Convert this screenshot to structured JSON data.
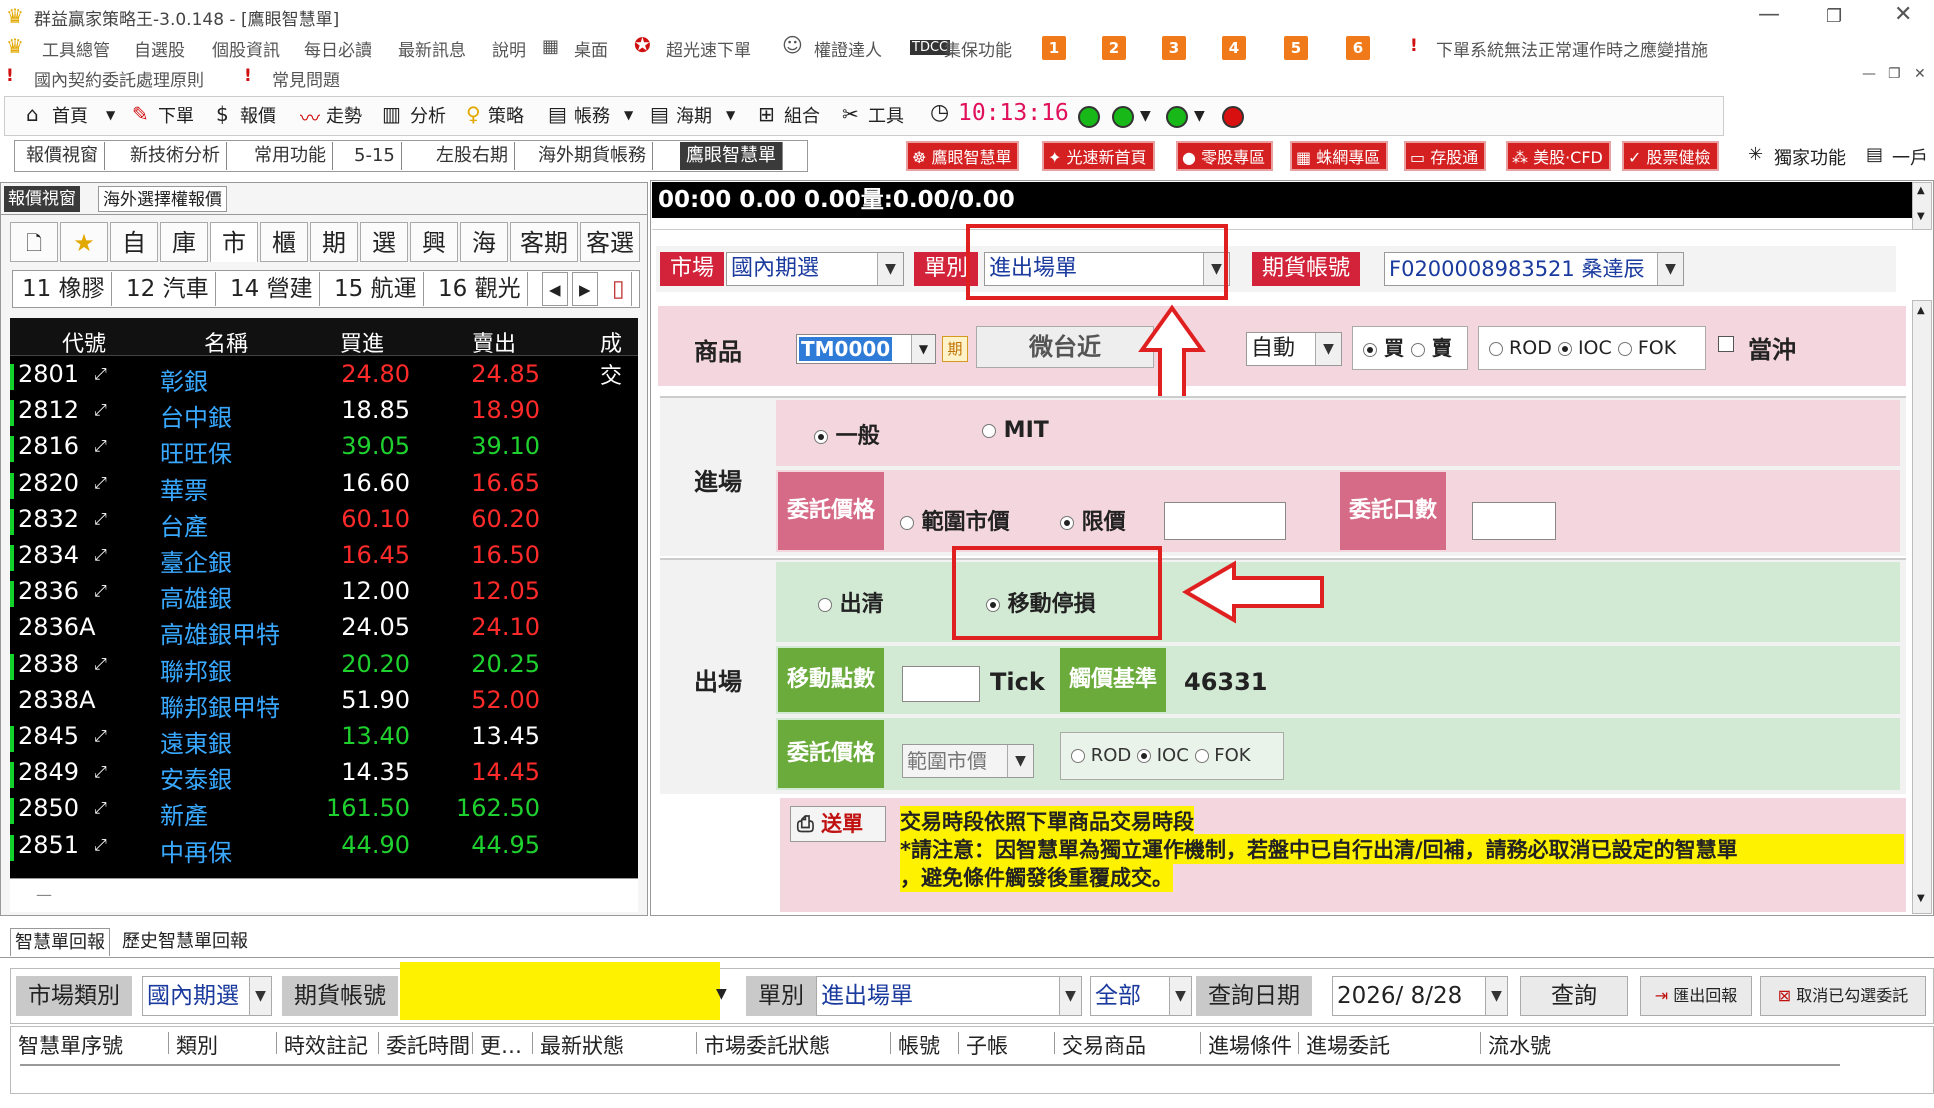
{
  "window": {
    "title": "群益贏家策略王-3.0.148 - [鷹眼智慧單]"
  },
  "menu": {
    "items": [
      "工具總管",
      "自選股",
      "個股資訊",
      "每日必讀",
      "最新訊息",
      "說明",
      "桌面",
      "超光速下單",
      "權證達人",
      "集保功能"
    ],
    "numbers": [
      "1",
      "2",
      "3",
      "4",
      "5",
      "6"
    ],
    "notice": "下單系統無法正常運作時之應變措施",
    "row2": [
      "國內契約委託處理原則",
      "常見問題"
    ]
  },
  "toolbar": {
    "items": [
      "首頁",
      "下單",
      "報價",
      "走勢",
      "分析",
      "策略",
      "帳務",
      "海期",
      "組合",
      "工具"
    ],
    "clock": "10:13:16"
  },
  "tabs": {
    "items": [
      "報價視窗",
      "新技術分析",
      "常用功能",
      "5-15",
      "左股右期",
      "海外期貨帳務",
      "鷹眼智慧單"
    ],
    "active": "鷹眼智慧單"
  },
  "redbuttons": [
    "鷹眼智慧單",
    "光速新首頁",
    "零股專區",
    "蛛網專區",
    "存股通",
    "美股·CFD",
    "股票健檢"
  ],
  "extra_buttons": [
    "獨家功能",
    "一戶"
  ],
  "left": {
    "tabs": [
      "報價視窗",
      "海外選擇權報價"
    ],
    "cattabs": [
      "自",
      "庫",
      "市",
      "櫃",
      "期",
      "選",
      "興",
      "海",
      "客期",
      "客選"
    ],
    "groups": [
      "11 橡膠",
      "12 汽車",
      "14 營建",
      "15 航運",
      "16 觀光"
    ],
    "columns": [
      "代號",
      "名稱",
      "買進",
      "賣出",
      "成交"
    ],
    "rows": [
      {
        "code": "2801",
        "name": "彰銀",
        "bid": "24.80",
        "ask": "24.85",
        "bidc": "#ff2a2a",
        "askc": "#ff2a2a",
        "mark": true
      },
      {
        "code": "2812",
        "name": "台中銀",
        "bid": "18.85",
        "ask": "18.90",
        "bidc": "#ffffff",
        "askc": "#ff2a2a",
        "mark": true
      },
      {
        "code": "2816",
        "name": "旺旺保",
        "bid": "39.05",
        "ask": "39.10",
        "bidc": "#1ed12e",
        "askc": "#1ed12e",
        "mark": true
      },
      {
        "code": "2820",
        "name": "華票",
        "bid": "16.60",
        "ask": "16.65",
        "bidc": "#ffffff",
        "askc": "#ff2a2a",
        "mark": true
      },
      {
        "code": "2832",
        "name": "台產",
        "bid": "60.10",
        "ask": "60.20",
        "bidc": "#ff2a2a",
        "askc": "#ff2a2a",
        "mark": true
      },
      {
        "code": "2834",
        "name": "臺企銀",
        "bid": "16.45",
        "ask": "16.50",
        "bidc": "#ff2a2a",
        "askc": "#ff2a2a",
        "mark": true
      },
      {
        "code": "2836",
        "name": "高雄銀",
        "bid": "12.00",
        "ask": "12.05",
        "bidc": "#ffffff",
        "askc": "#ff2a2a",
        "mark": true
      },
      {
        "code": "2836A",
        "name": "高雄銀甲特",
        "bid": "24.05",
        "ask": "24.10",
        "bidc": "#ffffff",
        "askc": "#ff2a2a",
        "mark": false
      },
      {
        "code": "2838",
        "name": "聯邦銀",
        "bid": "20.20",
        "ask": "20.25",
        "bidc": "#1ed12e",
        "askc": "#1ed12e",
        "mark": true
      },
      {
        "code": "2838A",
        "name": "聯邦銀甲特",
        "bid": "51.90",
        "ask": "52.00",
        "bidc": "#ffffff",
        "askc": "#ff2a2a",
        "mark": false
      },
      {
        "code": "2845",
        "name": "遠東銀",
        "bid": "13.40",
        "ask": "13.45",
        "bidc": "#1ed12e",
        "askc": "#ffffff",
        "mark": true
      },
      {
        "code": "2849",
        "name": "安泰銀",
        "bid": "14.35",
        "ask": "14.45",
        "bidc": "#ffffff",
        "askc": "#ff2a2a",
        "mark": true
      },
      {
        "code": "2850",
        "name": "新產",
        "bid": "161.50",
        "ask": "162.50",
        "bidc": "#1ed12e",
        "askc": "#1ed12e",
        "mark": true
      },
      {
        "code": "2851",
        "name": "中再保",
        "bid": "44.90",
        "ask": "44.95",
        "bidc": "#1ed12e",
        "askc": "#1ed12e",
        "mark": true
      }
    ]
  },
  "order": {
    "ticker_bar": "00:00    0.00 0.00量:0.00/0.00",
    "market_label": "市場",
    "market_value": "國內期選",
    "type_label": "單別",
    "type_value": "進出場單",
    "account_label": "期貨帳號",
    "account_value": "F0200008983521 桑達辰",
    "product_label": "商品",
    "product_code": "TM0000",
    "product_tag": "期",
    "product_name": "微台近",
    "auto": "自動",
    "buy": "買",
    "sell": "賣",
    "rod": "ROD",
    "ioc": "IOC",
    "fok": "FOK",
    "daytrade": "當沖",
    "entry_label": "進場",
    "normal": "一般",
    "mit": "MIT",
    "price_label": "委託價格",
    "range_market": "範圍市價",
    "limit": "限價",
    "qty_label": "委託口數",
    "exit_label": "出場",
    "clear": "出清",
    "trailing": "移動停損",
    "move_points": "移動點數",
    "tick": "Tick",
    "trigger_base": "觸價基準",
    "trigger_value": "46331",
    "exit_price_label": "委託價格",
    "exit_price_value": "範圍市價",
    "send": "送單",
    "note1": "交易時段依照下單商品交易時段",
    "note2": "*請注意：因智慧單為獨立運作機制，若盤中已自行出清/回補，請務必取消已設定的智慧單",
    "note3": "，避免條件觸發後重覆成交。"
  },
  "bottom": {
    "tabs": [
      "智慧單回報",
      "歷史智慧單回報"
    ],
    "market_type_label": "市場類別",
    "market_type_value": "國內期選",
    "account_label": "期貨帳號",
    "type_label": "單別",
    "type_value": "進出場單",
    "all_value": "全部",
    "date_label": "查詢日期",
    "date_value": "2026/ 8/28",
    "query": "查詢",
    "export": "匯出回報",
    "cancel": "取消已勾選委託",
    "columns": [
      "智慧單序號",
      "類別",
      "時效註記",
      "委託時間",
      "更…",
      "最新狀態",
      "市場委託狀態",
      "帳號",
      "子帳",
      "交易商品",
      "進場條件",
      "進場委託",
      "流水號"
    ]
  }
}
